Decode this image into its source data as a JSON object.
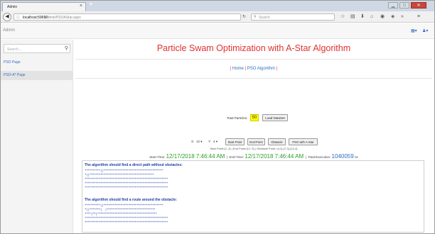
{
  "browser": {
    "tab_title": "Admin",
    "tab_close": "×",
    "new_tab": "+",
    "url_host": "localhost:59692",
    "url_path": "/Admin/PSOAStar.aspx",
    "search_placeholder": "Search",
    "window_controls": {
      "minimize": "▁",
      "maximize": "□",
      "close": "✕"
    },
    "toolbar_icons": [
      "star-icon",
      "reading-list-icon",
      "download-icon",
      "home-icon",
      "pocket-icon",
      "shield-icon",
      "chevron-icon",
      "menu-icon"
    ]
  },
  "app": {
    "brand": "Admin",
    "header_icons": [
      "grid-icon",
      "user-icon"
    ]
  },
  "sidebar": {
    "search_placeholder": "Search...",
    "search_glyph": "⚲",
    "items": [
      {
        "label": "PSO Page",
        "active": false
      },
      {
        "label": "PSO-A* Page",
        "active": true
      }
    ]
  },
  "main": {
    "title": "Particle Swam Optimization with A-Star Algorithm",
    "breadcrumbs": {
      "sep": "|",
      "home": "Home",
      "pso": "PSO Algorithm"
    },
    "total_particles_label": "Total Particles:",
    "total_particles_value": "50",
    "load_dataset_label": "Load DataSet",
    "x_label": "X:",
    "x_value": "12",
    "y_label": "Y:",
    "y_value": "4",
    "buttons": {
      "start_point": "Start-Point",
      "end_point": "End-Point",
      "obstacle": "Obstacle",
      "pso_astar": "PSO with A-Star"
    },
    "points_line": "Start Point:(2, 4)  | End Point:(12, 5)  | Obstacle Point: (4,3),(7,3),(12,4)",
    "start_time_label": "Start-Time:",
    "start_time": "12/17/2018 7:46:44 AM",
    "end_time_label": "End-Time:",
    "end_time": "12/17/2018 7:46:44 AM",
    "exec_label": "Total-Execution:",
    "exec_value": "1040059",
    "exec_unit": "ns",
    "section1_heading": "The algorithm should find a direct path without obstacles:",
    "section2_heading": "The algorithm should find a route around the obstacle:",
    "grid1": [
      "**********||**************************************",
      "*||*****************************************",
      "*****************************************************",
      "*****************************************************",
      "*****************************************************"
    ],
    "grid2": [
      "**********||**************************************",
      "*||*******|  |*******************************",
      "****|**|**************************************",
      "*****************************************************",
      "*****************************************************"
    ]
  }
}
